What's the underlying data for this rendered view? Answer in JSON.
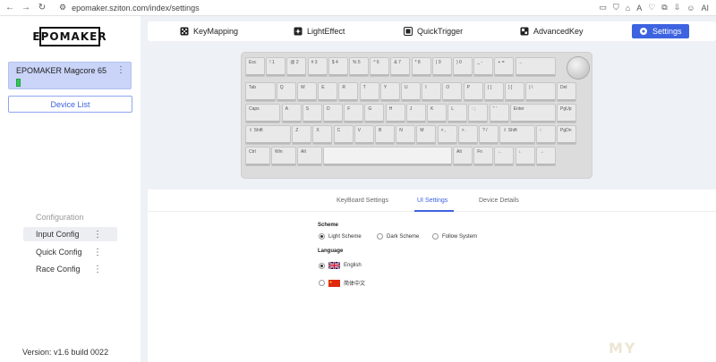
{
  "browser": {
    "url": "epomaker.sziton.com/index/settings",
    "ai_label": "AI"
  },
  "sidebar": {
    "logo": "EPOMAKER",
    "device_name": "EPOMAKER Magcore 65",
    "device_list_label": "Device List",
    "config_title": "Configuration",
    "config_items": [
      {
        "label": "Input Config"
      },
      {
        "label": "Quick Config"
      },
      {
        "label": "Race Config"
      }
    ],
    "version": "Version: v1.6 build 0022"
  },
  "tabs": [
    {
      "label": "KeyMapping",
      "icon": "keymapping-icon"
    },
    {
      "label": "LightEffect",
      "icon": "light-effect-icon"
    },
    {
      "label": "QuickTrigger",
      "icon": "quick-trigger-icon"
    },
    {
      "label": "AdvancedKey",
      "icon": "advanced-key-icon"
    },
    {
      "label": "Settings",
      "icon": "gear-icon",
      "active": true
    }
  ],
  "keyboard": {
    "rows": [
      [
        "Esc",
        "! 1",
        "@ 2",
        "# 3",
        "$ 4",
        "% 5",
        "^ 6",
        "& 7",
        "* 8",
        "( 9",
        ") 0",
        "_ -",
        "+ =",
        "←"
      ],
      [
        "Tab",
        "Q",
        "W",
        "E",
        "R",
        "T",
        "Y",
        "U",
        "I",
        "O",
        "P",
        "{ [",
        "} ]",
        "| \\",
        "Del"
      ],
      [
        "Caps",
        "A",
        "S",
        "D",
        "F",
        "G",
        "H",
        "J",
        "K",
        "L",
        ": ;",
        "\" '",
        "Enter",
        "PgUp"
      ],
      [
        "⇧ Shift",
        "Z",
        "X",
        "C",
        "V",
        "B",
        "N",
        "M",
        "< ,",
        "> .",
        "? /",
        "⇧ Shift",
        "↑",
        "PgDn"
      ],
      [
        "Ctrl",
        "Win",
        "Alt",
        "",
        "Alt",
        "Fn",
        "←",
        "↓",
        "→"
      ]
    ]
  },
  "settings": {
    "sub_tabs": [
      "KeyBoard Settings",
      "UI Settings",
      "Device Details"
    ],
    "active_sub_tab": "UI Settings",
    "scheme": {
      "title": "Scheme",
      "options": [
        "Light Scheme",
        "Dark Scheme",
        "Follow System"
      ],
      "selected": "Light Scheme"
    },
    "language": {
      "title": "Language",
      "options": [
        "English",
        "简体中文"
      ],
      "selected": "English"
    }
  },
  "colors": {
    "accent": "#3d63e0",
    "device_card_bg": "#c9d4f8",
    "battery": "#34c759"
  },
  "watermark": "MY"
}
